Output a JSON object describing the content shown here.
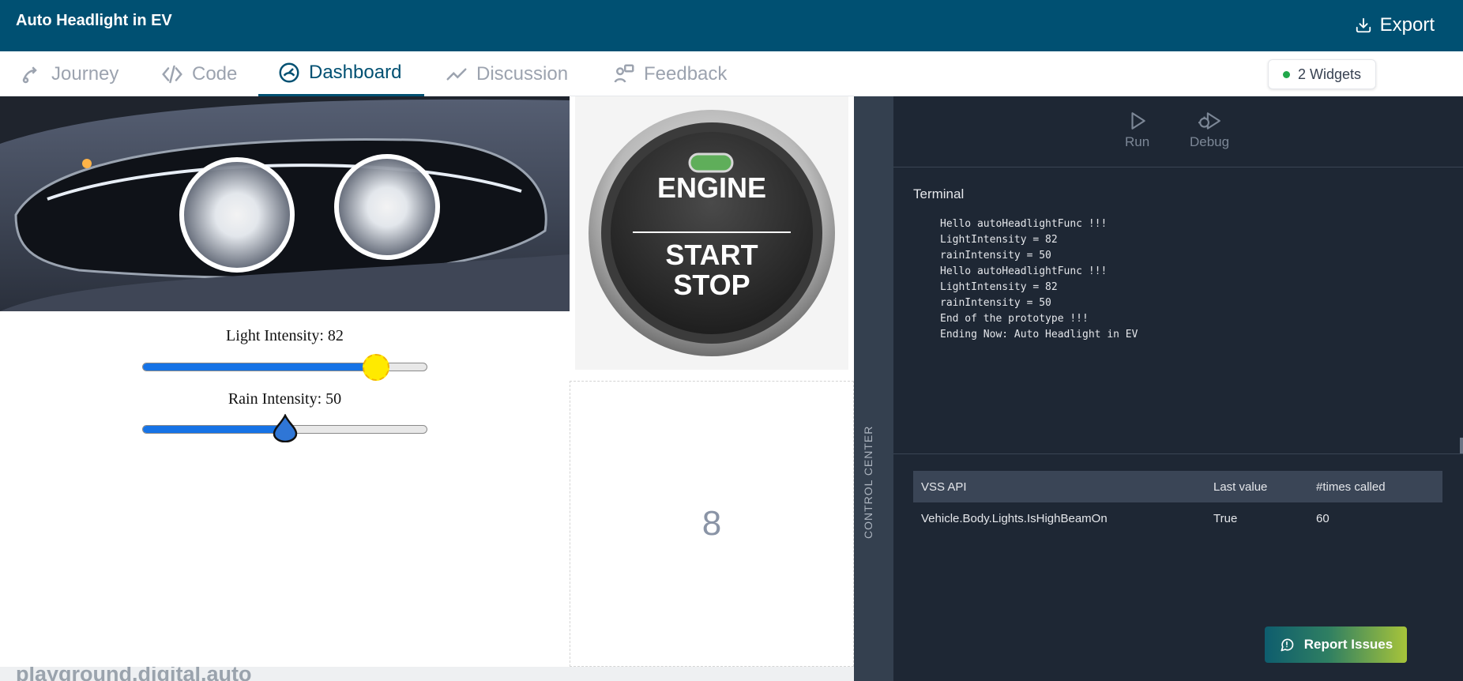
{
  "header": {
    "title": "Auto Headlight in EV",
    "export_label": "Export"
  },
  "tabs": [
    {
      "label": "Journey",
      "icon": "journey-icon"
    },
    {
      "label": "Code",
      "icon": "code-icon"
    },
    {
      "label": "Dashboard",
      "icon": "dashboard-icon",
      "active": true
    },
    {
      "label": "Discussion",
      "icon": "chart-line-icon"
    },
    {
      "label": "Feedback",
      "icon": "feedback-icon"
    }
  ],
  "widgets_badge": {
    "label": "2 Widgets",
    "status_color": "#22a84b"
  },
  "sliders": {
    "light": {
      "label": "Light Intensity: 82",
      "value": 82
    },
    "rain": {
      "label": "Rain Intensity: 50",
      "value": 50
    }
  },
  "engine_button": {
    "line1": "ENGINE",
    "line2": "START",
    "line3": "STOP"
  },
  "placeholder_value": "8",
  "footer_brand": "playground.digital.auto",
  "control_center": {
    "label": "CONTROL CENTER",
    "run_label": "Run",
    "debug_label": "Debug",
    "terminal_title": "Terminal",
    "terminal_lines": [
      "Hello autoHeadlightFunc !!!",
      "LightIntensity = 82",
      "rainIntensity = 50",
      "Hello autoHeadlightFunc !!!",
      "LightIntensity = 82",
      "rainIntensity = 50",
      "End of the prototype !!!",
      "Ending Now: Auto Headlight in EV"
    ],
    "vss_table": {
      "headers": [
        "VSS API",
        "Last value",
        "#times called"
      ],
      "rows": [
        [
          "Vehicle.Body.Lights.IsHighBeamOn",
          "True",
          "60"
        ]
      ]
    }
  },
  "report_button": {
    "label": "Report Issues"
  }
}
